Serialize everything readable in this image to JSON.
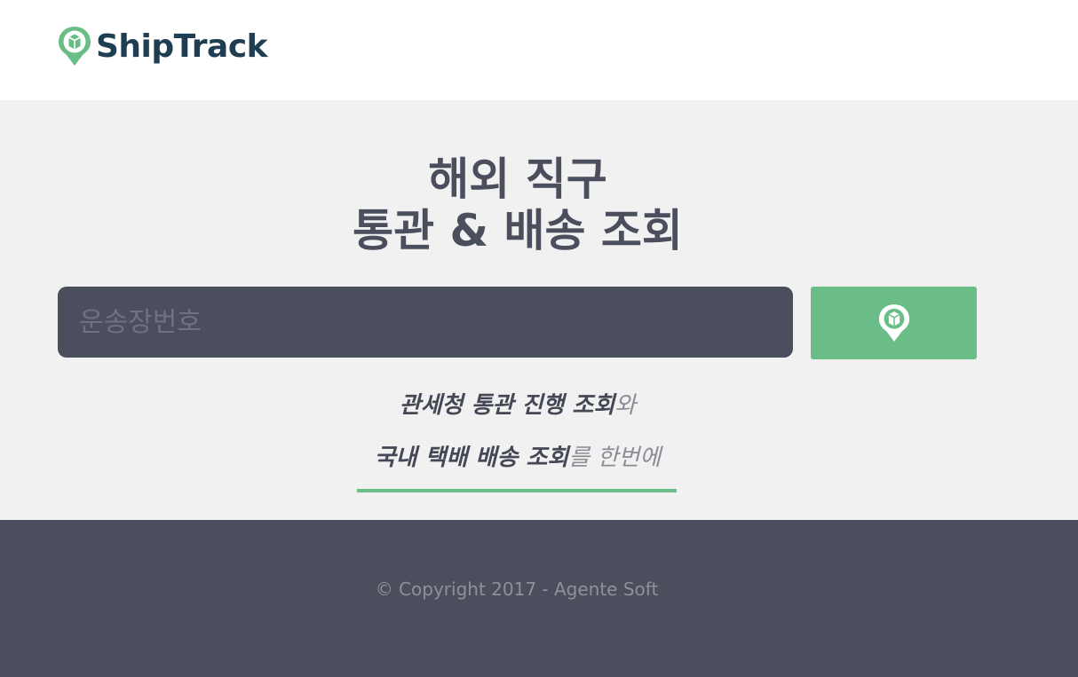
{
  "header": {
    "logo": {
      "text": "ShipTrack",
      "icon": "map-pin-box-icon",
      "pin_color": "#6bbd88",
      "text_color": "#1f3e52"
    }
  },
  "hero": {
    "title_line1": "해외 직구",
    "title_line2": "통관 & 배송 조회",
    "search": {
      "placeholder": "운송장번호",
      "value": ""
    },
    "search_button": {
      "icon": "map-pin-box-icon",
      "color": "#6bbd88"
    },
    "tagline": {
      "line1_bold": "관세청 통관 진행 조회",
      "line1_rest": "와",
      "line2_bold": "국내 택배 배송 조회",
      "line2_rest": "를 한번에"
    },
    "accent_color": "#6bbd88"
  },
  "footer": {
    "copyright": "© Copyright 2017 - Agente Soft",
    "background": "#4b4e5d"
  }
}
